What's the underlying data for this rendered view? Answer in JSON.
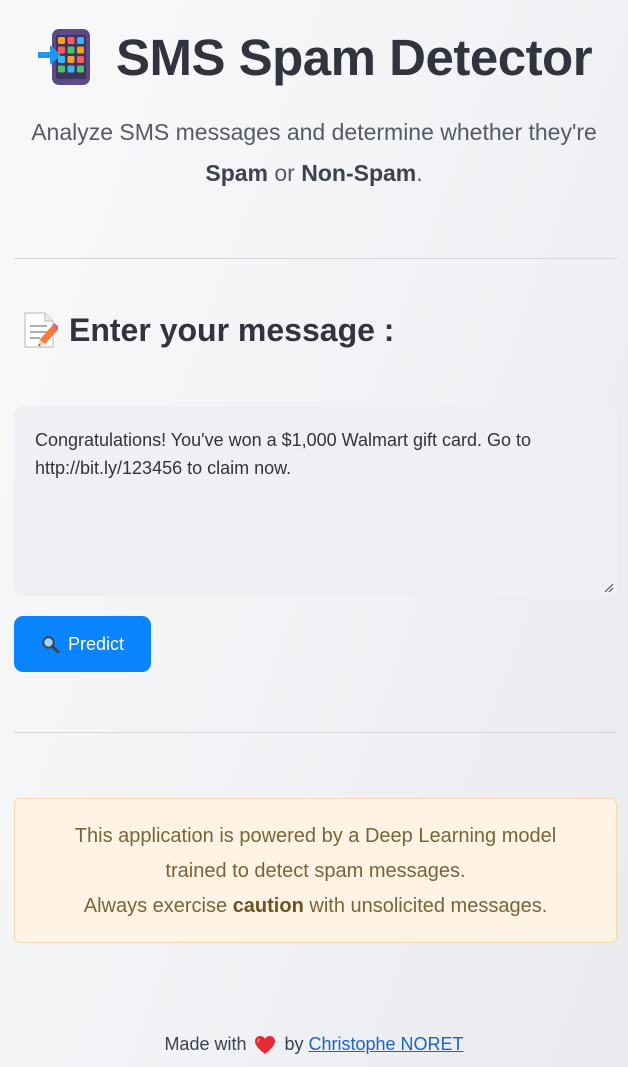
{
  "header": {
    "title": "SMS Spam Detector",
    "icon": "mobile-phone-arrow-icon"
  },
  "subtitle": {
    "line1": "Analyze SMS messages and determine whether they're",
    "spam_label": "Spam",
    "or_word": "or",
    "nonspam_label": "Non-Spam",
    "end_punct": "."
  },
  "input_section": {
    "icon": "memo-icon",
    "heading": "Enter your message :",
    "message_value": "Congratulations! You've won a $1,000 Walmart gift card. Go to http://bit.ly/123456 to claim now."
  },
  "predict_button": {
    "icon": "magnifying-glass-icon",
    "label": "Predict",
    "color": "#0a84ff"
  },
  "info": {
    "line1": "This application is powered by a Deep Learning model",
    "line2": "trained to detect spam messages.",
    "line3_prefix": "Always exercise",
    "line3_bold": "caution",
    "line3_suffix": "with unsolicited messages.",
    "background_color": "#fff3e3"
  },
  "footer": {
    "made_with": "Made with",
    "icon": "heart-icon",
    "by": "by",
    "author": "Christophe NORET"
  }
}
